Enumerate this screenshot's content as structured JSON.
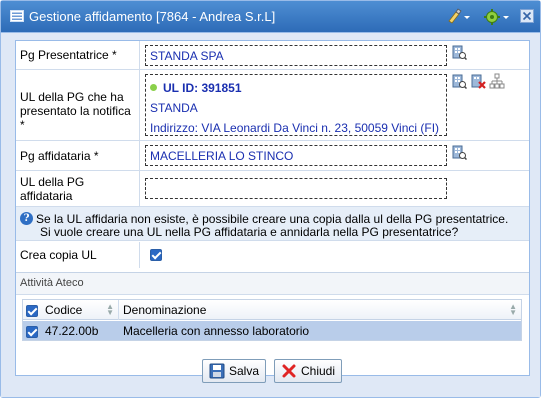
{
  "window": {
    "title": "Gestione affidamento [7864 - Andrea S.r.L]"
  },
  "form": {
    "pg_presentatrice": {
      "label": "Pg Presentatrice *",
      "value": "STANDA SPA"
    },
    "ul_pg": {
      "label": "UL della PG che ha presentato la notifica *",
      "ul_id": "UL ID: 391851",
      "name": "STANDA",
      "address": "Indirizzo: VIA Leonardi Da Vinci n. 23, 50059 Vinci (FI)"
    },
    "pg_affidataria": {
      "label": "Pg affidataria *",
      "value": "MACELLERIA LO STINCO"
    },
    "ul_pg_affidataria": {
      "label": "UL della PG affidataria",
      "value": ""
    },
    "info": {
      "line1": "Se la UL affidaria non esiste, è possibile creare una copia dalla ul della PG presentatrice.",
      "line2": "Si vuole creare una UL nella PG affidataria e annidarla nella PG presentatrice?"
    },
    "crea_copia": {
      "label": "Crea copia UL",
      "checked": true
    }
  },
  "ateco": {
    "title": "Attività Ateco",
    "columns": [
      "Codice",
      "Denominazione"
    ],
    "rows": [
      {
        "code": "47.22.00b",
        "name": "Macelleria con annesso laboratorio",
        "checked": true
      }
    ]
  },
  "buttons": {
    "save": "Salva",
    "close": "Chiudi"
  }
}
